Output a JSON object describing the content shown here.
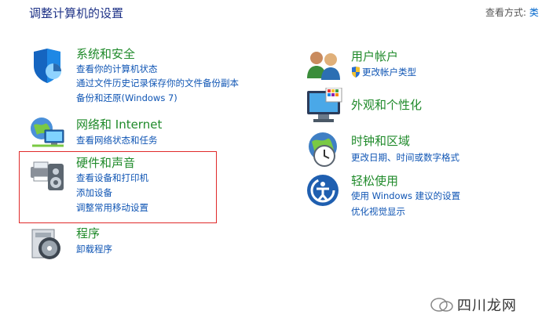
{
  "header": {
    "title": "调整计算机的设置",
    "view_label": "查看方式:",
    "view_value": "类"
  },
  "categories": [
    {
      "id": "system-security",
      "name": "系统和安全",
      "icon": "shield-icon",
      "links": [
        "查看你的计算机状态",
        "通过文件历史记录保存你的文件备份副本",
        "备份和还原(Windows 7)"
      ]
    },
    {
      "id": "network",
      "name": "网络和 Internet",
      "icon": "network-globe-icon",
      "links": [
        "查看网络状态和任务"
      ]
    },
    {
      "id": "hardware-sound",
      "name": "硬件和声音",
      "icon": "printer-speaker-icon",
      "links": [
        "查看设备和打印机",
        "添加设备",
        "调整常用移动设置"
      ]
    },
    {
      "id": "programs",
      "name": "程序",
      "icon": "programs-disc-icon",
      "links": [
        "卸载程序"
      ]
    },
    {
      "id": "user-accounts",
      "name": "用户帐户",
      "icon": "users-icon",
      "links": [
        "更改帐户类型"
      ]
    },
    {
      "id": "appearance",
      "name": "外观和个性化",
      "icon": "monitor-palette-icon",
      "links": []
    },
    {
      "id": "clock-region",
      "name": "时钟和区域",
      "icon": "clock-globe-icon",
      "links": [
        "更改日期、时间或数字格式"
      ]
    },
    {
      "id": "ease-access",
      "name": "轻松使用",
      "icon": "accessibility-icon",
      "links": [
        "使用 Windows 建议的设置",
        "优化视觉显示"
      ]
    }
  ],
  "watermark": {
    "text": "四川龙网"
  },
  "colors": {
    "category_name": "#1f8a2a",
    "link": "#0f55b4",
    "title": "#1e3287",
    "highlight_box": "#e02a2a"
  }
}
